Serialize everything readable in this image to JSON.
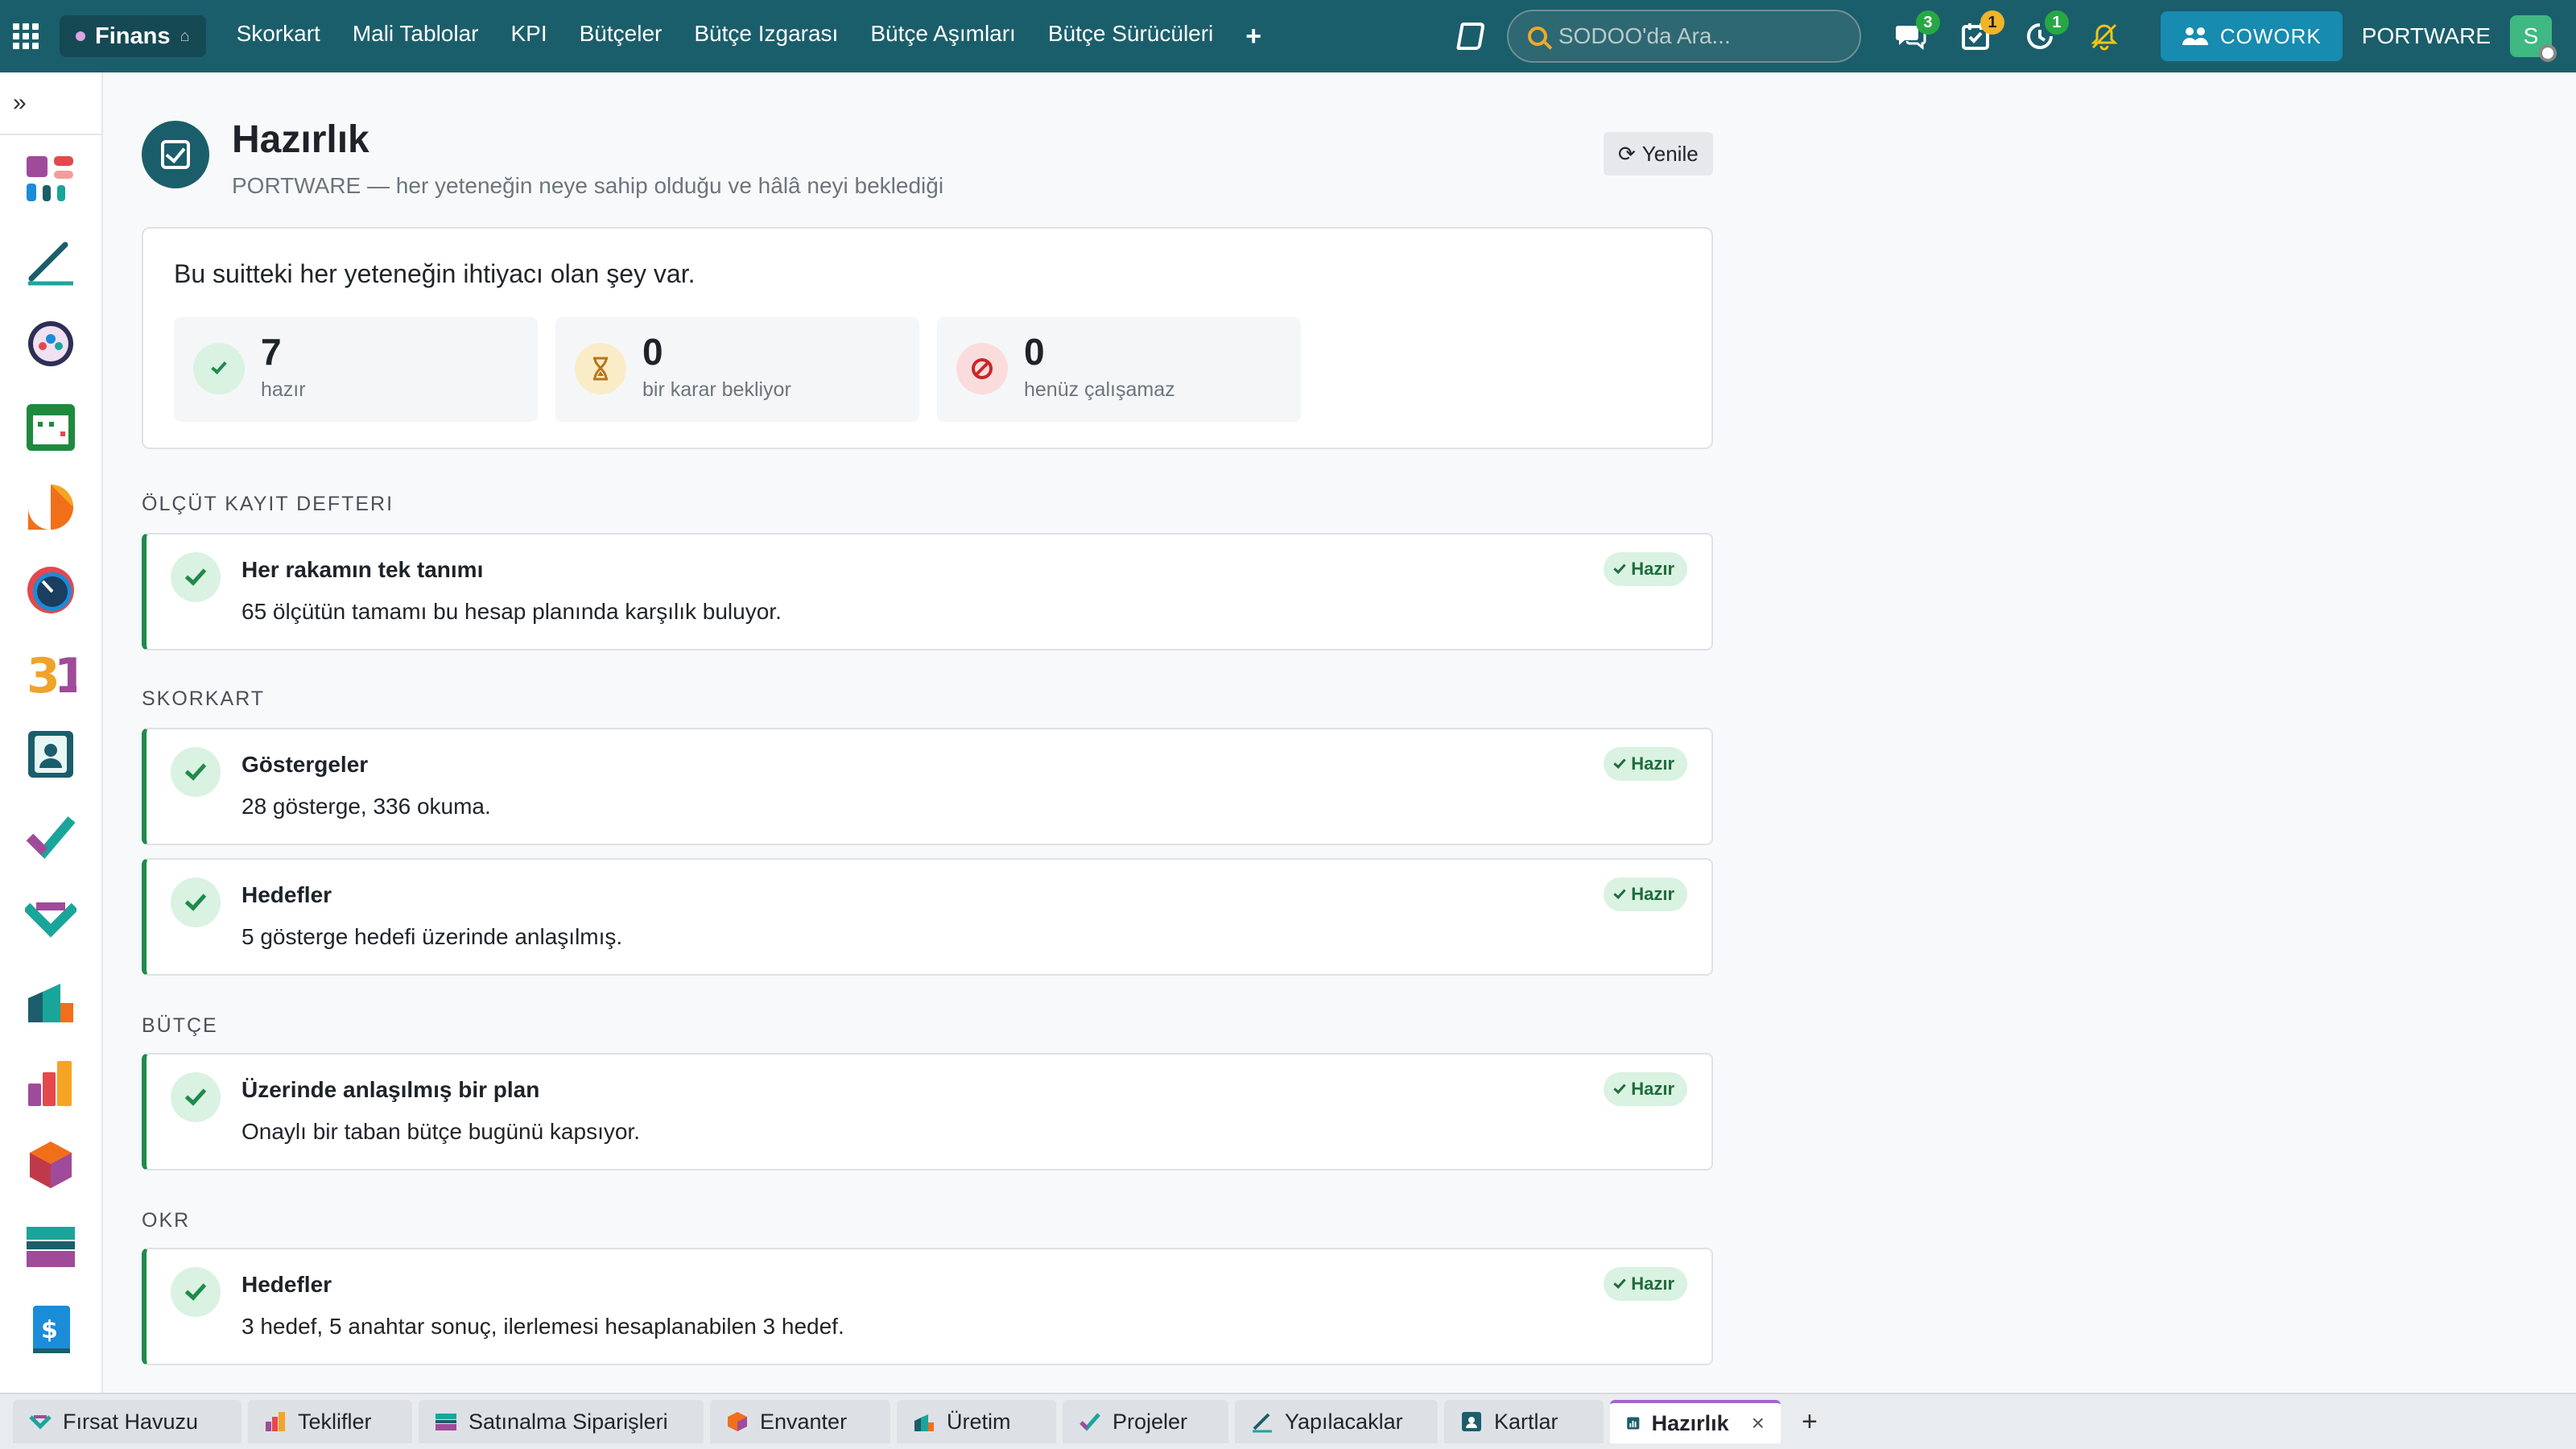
{
  "topbar": {
    "app_name": "Finans",
    "menu": [
      "Skorkart",
      "Mali Tablolar",
      "KPI",
      "Bütçeler",
      "Bütçe Izgarası",
      "Bütçe Aşımları",
      "Bütçe Sürücüleri"
    ],
    "search_placeholder": "SODOO'da Ara...",
    "messages_badge": "3",
    "activities_badge": "1",
    "timer_badge": "1",
    "cowork_label": "COWORK",
    "company": "PORTWARE",
    "avatar_letter": "S"
  },
  "page": {
    "title": "Hazırlık",
    "subtitle": "PORTWARE — her yeteneğin neye sahip olduğu ve hâlâ neyi beklediği",
    "refresh_label": "Yenile"
  },
  "summary": {
    "text": "Bu suitteki her yeteneğin ihtiyacı olan şey var.",
    "stats": [
      {
        "value": "7",
        "label": "hazır",
        "color": "#1f8a4c"
      },
      {
        "value": "0",
        "label": "bir karar bekliyor",
        "color": "#b8741a"
      },
      {
        "value": "0",
        "label": "henüz çalışamaz",
        "color": "#c62828"
      }
    ]
  },
  "sections": [
    {
      "heading": "ÖLÇÜT KAYIT DEFTERI",
      "items": [
        {
          "title": "Her rakamın tek tanımı",
          "desc": "65 ölçütün tamamı bu hesap planında karşılık buluyor.",
          "status": "Hazır"
        }
      ]
    },
    {
      "heading": "SKORKART",
      "items": [
        {
          "title": "Göstergeler",
          "desc": "28 gösterge, 336 okuma.",
          "status": "Hazır"
        },
        {
          "title": "Hedefler",
          "desc": "5 gösterge hedefi üzerinde anlaşılmış.",
          "status": "Hazır"
        }
      ]
    },
    {
      "heading": "BÜTÇE",
      "items": [
        {
          "title": "Üzerinde anlaşılmış bir plan",
          "desc": "Onaylı bir taban bütçe bugünü kapsıyor.",
          "status": "Hazır"
        }
      ]
    },
    {
      "heading": "OKR",
      "items": [
        {
          "title": "Hedefler",
          "desc": "3 hedef, 5 anahtar sonuç, ilerlemesi hesaplanabilen 3 hedef.",
          "status": "Hazır"
        }
      ]
    }
  ],
  "tabs": [
    {
      "label": "Fırsat Havuzu",
      "icon": "crm-icon"
    },
    {
      "label": "Teklifler",
      "icon": "sales-icon"
    },
    {
      "label": "Satınalma Siparişleri",
      "icon": "purchase-icon"
    },
    {
      "label": "Envanter",
      "icon": "inventory-icon"
    },
    {
      "label": "Üretim",
      "icon": "manufacturing-icon"
    },
    {
      "label": "Projeler",
      "icon": "project-icon"
    },
    {
      "label": "Yapılacaklar",
      "icon": "todo-icon"
    },
    {
      "label": "Kartlar",
      "icon": "contacts-icon"
    },
    {
      "label": "Hazırlık",
      "icon": "readiness-icon",
      "active": true
    }
  ],
  "colors": {
    "brand": "#1b5e6b",
    "ready": "#1f8a4c",
    "cowork": "#178bb0"
  }
}
